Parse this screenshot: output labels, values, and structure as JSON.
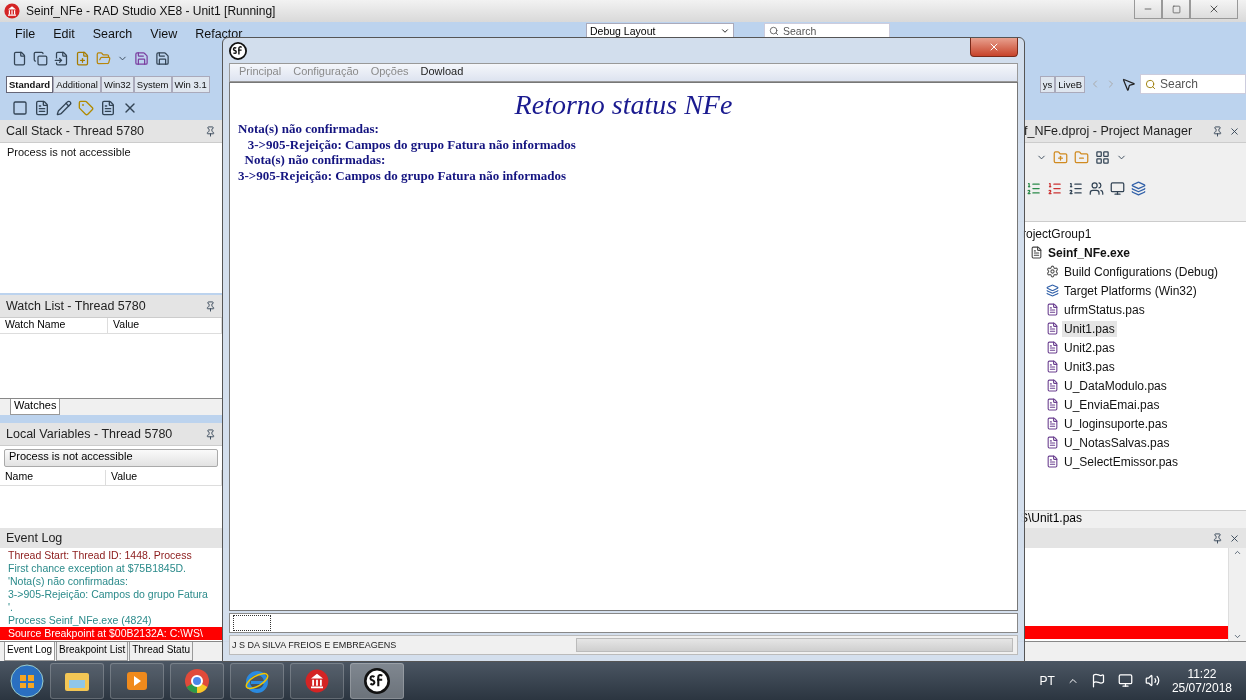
{
  "ide": {
    "title": "Seinf_NFe - RAD Studio XE8 - Unit1 [Running]",
    "menu": [
      "File",
      "Edit",
      "Search",
      "View",
      "Refactor"
    ],
    "layout_combo": "Debug Layout",
    "search": {
      "placeholder": "Search"
    },
    "palette_tabs": [
      {
        "label": "Standard",
        "selected": true
      },
      {
        "label": "Additional",
        "selected": false
      },
      {
        "label": "Win32",
        "selected": false
      },
      {
        "label": "System",
        "selected": false
      },
      {
        "label": "Win 3.1",
        "selected": false
      }
    ],
    "palette_tabs_right": [
      {
        "label": "ys",
        "selected": false
      },
      {
        "label": "LiveB",
        "selected": false
      }
    ],
    "palette_search": {
      "placeholder": "Search"
    }
  },
  "call_stack": {
    "title": "Call Stack - Thread 5780",
    "message": "Process is not accessible"
  },
  "watch_list": {
    "title": "Watch List - Thread 5780",
    "columns": [
      "Watch Name",
      "Value"
    ],
    "tabs": [
      {
        "label": "Watches",
        "selected": true
      }
    ]
  },
  "local_variables": {
    "title": "Local Variables - Thread 5780",
    "combo": "Process is not accessible",
    "columns": [
      "Name",
      "Value"
    ]
  },
  "project_manager": {
    "title": "f_NFe.dproj - Project Manager",
    "path": "S\\Unit1.pas",
    "tree": [
      {
        "label": "rojectGroup1",
        "kind": "group",
        "selected": false,
        "children": [
          {
            "label": "Seinf_NFe.exe",
            "kind": "project",
            "selected": false,
            "children": [
              {
                "label": "Build Configurations (Debug)",
                "kind": "config",
                "selected": false
              },
              {
                "label": "Target Platforms (Win32)",
                "kind": "platforms",
                "selected": false
              },
              {
                "label": "ufrmStatus.pas",
                "kind": "file",
                "selected": false
              },
              {
                "label": "Unit1.pas",
                "kind": "file",
                "selected": true
              },
              {
                "label": "Unit2.pas",
                "kind": "file",
                "selected": false
              },
              {
                "label": "Unit3.pas",
                "kind": "file",
                "selected": false
              },
              {
                "label": "U_DataModulo.pas",
                "kind": "file",
                "selected": false
              },
              {
                "label": "U_EnviaEmai.pas",
                "kind": "file",
                "selected": false
              },
              {
                "label": "U_loginsuporte.pas",
                "kind": "file",
                "selected": false
              },
              {
                "label": "U_NotasSalvas.pas",
                "kind": "file",
                "selected": false
              },
              {
                "label": "U_SelectEmissor.pas",
                "kind": "file",
                "selected": false
              }
            ]
          }
        ]
      }
    ]
  },
  "event_log": {
    "title": "Event Log",
    "lines": [
      {
        "text": "Thread Start: Thread ID: 1448. Process",
        "kind": "thread"
      },
      {
        "text": "First chance exception at $75B1845D.",
        "kind": "info"
      },
      {
        "text": "'Nota(s) não confirmadas:",
        "kind": "info"
      },
      {
        "text": "3->905-Rejeição: Campos do grupo Fatura",
        "kind": "info"
      },
      {
        "text": "'.",
        "kind": "info"
      },
      {
        "text": "Process Seinf_NFe.exe (4824)",
        "kind": "info"
      },
      {
        "text": "Source Breakpoint at $00B2132A: C:\\WS\\",
        "kind": "breakpoint"
      }
    ]
  },
  "bottom_tabs": [
    {
      "label": "Event Log",
      "selected": true
    },
    {
      "label": "Breakpoint List",
      "selected": false
    },
    {
      "label": "Thread Statu",
      "selected": false
    }
  ],
  "dialog": {
    "menu": [
      {
        "label": "Principal",
        "disabled": true
      },
      {
        "label": "Configuração",
        "disabled": true
      },
      {
        "label": "Opções",
        "disabled": true
      },
      {
        "label": "Dowload",
        "disabled": false
      }
    ],
    "heading": "Retorno status NFe",
    "lines": [
      "Nota(s) não confirmadas:",
      "   3->905-Rejeição: Campos do grupo Fatura não informados",
      "  Nota(s) não confirmadas:",
      "3->905-Rejeição: Campos do grupo Fatura não informados"
    ],
    "status": "J S DA SILVA FREIOS E EMBREAGENS"
  },
  "taskbar": {
    "apps": [
      {
        "kind": "explorer",
        "selected": false
      },
      {
        "kind": "media",
        "selected": false
      },
      {
        "kind": "chrome",
        "selected": false
      },
      {
        "kind": "ie",
        "selected": false
      },
      {
        "kind": "rad",
        "selected": false
      },
      {
        "kind": "sf",
        "selected": true
      }
    ],
    "language": "PT",
    "time": "11:22",
    "date": "25/07/2018"
  }
}
